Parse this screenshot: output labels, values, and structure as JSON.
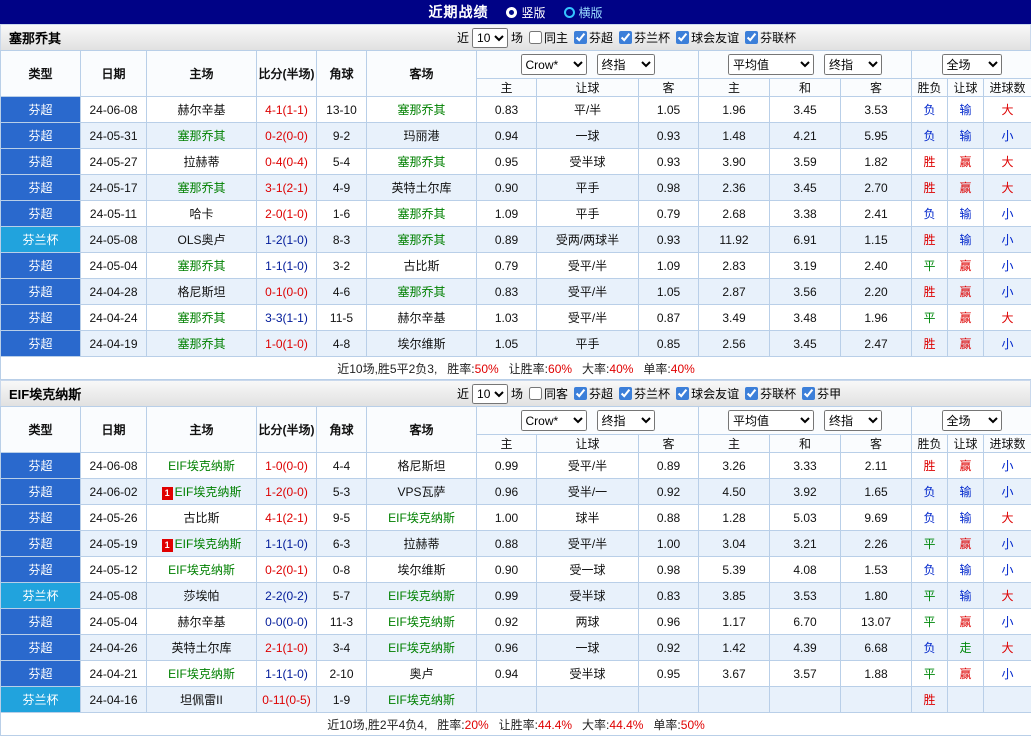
{
  "topbar": {
    "title": "近期战绩",
    "vertical": "竖版",
    "horizontal": "横版"
  },
  "controls": {
    "near": "近",
    "count": "10",
    "games": "场",
    "crow": "Crow*",
    "final1": "终指",
    "avg": "平均值",
    "final2": "终指",
    "full": "全场"
  },
  "columns": {
    "type": "类型",
    "date": "日期",
    "home": "主场",
    "score": "比分(半场)",
    "corner": "角球",
    "away": "客场",
    "sub": [
      "主",
      "让球",
      "客",
      "主",
      "和",
      "客",
      "胜负",
      "让球",
      "进球数"
    ]
  },
  "sections": [
    {
      "team": "塞那乔其",
      "filter": {
        "same": "同主",
        "same_checked": false,
        "leagues": [
          {
            "label": "芬超",
            "checked": true
          },
          {
            "label": "芬兰杯",
            "checked": true
          },
          {
            "label": "球会友谊",
            "checked": true
          },
          {
            "label": "芬联杯",
            "checked": true
          }
        ]
      },
      "rows": [
        {
          "comp": "芬超",
          "kindcls": "t-league",
          "date": "24-06-08",
          "badge": "",
          "home": "赫尔辛基",
          "homecls": "",
          "score": "4-1(1-1)",
          "scorecls": "c-red",
          "corners": "13-10",
          "away": "塞那乔其",
          "awaycls": "focus",
          "o1": "0.83",
          "hc": "平/半",
          "o2": "1.05",
          "e1": "1.96",
          "e2": "3.45",
          "e3": "3.53",
          "r1": "负",
          "r1cls": "c-blue",
          "r2": "输",
          "r2cls": "c-blue",
          "r3": "大",
          "r3cls": "c-red"
        },
        {
          "comp": "芬超",
          "kindcls": "t-league",
          "date": "24-05-31",
          "badge": "",
          "home": "塞那乔其",
          "homecls": "focus",
          "score": "0-2(0-0)",
          "scorecls": "c-red",
          "corners": "9-2",
          "away": "玛丽港",
          "awaycls": "",
          "o1": "0.94",
          "hc": "一球",
          "o2": "0.93",
          "e1": "1.48",
          "e2": "4.21",
          "e3": "5.95",
          "r1": "负",
          "r1cls": "c-blue",
          "r2": "输",
          "r2cls": "c-blue",
          "r3": "小",
          "r3cls": "c-blue"
        },
        {
          "comp": "芬超",
          "kindcls": "t-league",
          "date": "24-05-27",
          "badge": "",
          "home": "拉赫蒂",
          "homecls": "",
          "score": "0-4(0-4)",
          "scorecls": "c-red",
          "corners": "5-4",
          "away": "塞那乔其",
          "awaycls": "focus",
          "o1": "0.95",
          "hc": "受半球",
          "o2": "0.93",
          "e1": "3.90",
          "e2": "3.59",
          "e3": "1.82",
          "r1": "胜",
          "r1cls": "c-red",
          "r2": "赢",
          "r2cls": "c-red",
          "r3": "大",
          "r3cls": "c-red"
        },
        {
          "comp": "芬超",
          "kindcls": "t-league",
          "date": "24-05-17",
          "badge": "",
          "home": "塞那乔其",
          "homecls": "focus",
          "score": "3-1(2-1)",
          "scorecls": "c-red",
          "corners": "4-9",
          "away": "英特土尔库",
          "awaycls": "",
          "o1": "0.90",
          "hc": "平手",
          "o2": "0.98",
          "e1": "2.36",
          "e2": "3.45",
          "e3": "2.70",
          "r1": "胜",
          "r1cls": "c-red",
          "r2": "赢",
          "r2cls": "c-red",
          "r3": "大",
          "r3cls": "c-red"
        },
        {
          "comp": "芬超",
          "kindcls": "t-league",
          "date": "24-05-11",
          "badge": "",
          "home": "哈卡",
          "homecls": "",
          "score": "2-0(1-0)",
          "scorecls": "c-red",
          "corners": "1-6",
          "away": "塞那乔其",
          "awaycls": "focus",
          "o1": "1.09",
          "hc": "平手",
          "o2": "0.79",
          "e1": "2.68",
          "e2": "3.38",
          "e3": "2.41",
          "r1": "负",
          "r1cls": "c-blue",
          "r2": "输",
          "r2cls": "c-blue",
          "r3": "小",
          "r3cls": "c-blue"
        },
        {
          "comp": "芬兰杯",
          "kindcls": "t-cup",
          "date": "24-05-08",
          "badge": "",
          "home": "OLS奥卢",
          "homecls": "",
          "score": "1-2(1-0)",
          "scorecls": "c-navy",
          "corners": "8-3",
          "away": "塞那乔其",
          "awaycls": "focus",
          "o1": "0.89",
          "hc": "受两/两球半",
          "o2": "0.93",
          "e1": "11.92",
          "e2": "6.91",
          "e3": "1.15",
          "r1": "胜",
          "r1cls": "c-red",
          "r2": "输",
          "r2cls": "c-blue",
          "r3": "小",
          "r3cls": "c-blue"
        },
        {
          "comp": "芬超",
          "kindcls": "t-league",
          "date": "24-05-04",
          "badge": "",
          "home": "塞那乔其",
          "homecls": "focus",
          "score": "1-1(1-0)",
          "scorecls": "c-navy",
          "corners": "3-2",
          "away": "古比斯",
          "awaycls": "",
          "o1": "0.79",
          "hc": "受平/半",
          "o2": "1.09",
          "e1": "2.83",
          "e2": "3.19",
          "e3": "2.40",
          "r1": "平",
          "r1cls": "c-green",
          "r2": "赢",
          "r2cls": "c-red",
          "r3": "小",
          "r3cls": "c-blue"
        },
        {
          "comp": "芬超",
          "kindcls": "t-league",
          "date": "24-04-28",
          "badge": "",
          "home": "格尼斯坦",
          "homecls": "",
          "score": "0-1(0-0)",
          "scorecls": "c-red",
          "corners": "4-6",
          "away": "塞那乔其",
          "awaycls": "focus",
          "o1": "0.83",
          "hc": "受平/半",
          "o2": "1.05",
          "e1": "2.87",
          "e2": "3.56",
          "e3": "2.20",
          "r1": "胜",
          "r1cls": "c-red",
          "r2": "赢",
          "r2cls": "c-red",
          "r3": "小",
          "r3cls": "c-blue"
        },
        {
          "comp": "芬超",
          "kindcls": "t-league",
          "date": "24-04-24",
          "badge": "",
          "home": "塞那乔其",
          "homecls": "focus",
          "score": "3-3(1-1)",
          "scorecls": "c-navy",
          "corners": "11-5",
          "away": "赫尔辛基",
          "awaycls": "",
          "o1": "1.03",
          "hc": "受平/半",
          "o2": "0.87",
          "e1": "3.49",
          "e2": "3.48",
          "e3": "1.96",
          "r1": "平",
          "r1cls": "c-green",
          "r2": "赢",
          "r2cls": "c-red",
          "r3": "大",
          "r3cls": "c-red"
        },
        {
          "comp": "芬超",
          "kindcls": "t-league",
          "date": "24-04-19",
          "badge": "",
          "home": "塞那乔其",
          "homecls": "focus",
          "score": "1-0(1-0)",
          "scorecls": "c-red",
          "corners": "4-8",
          "away": "埃尔维斯",
          "awaycls": "",
          "o1": "1.05",
          "hc": "平手",
          "o2": "0.85",
          "e1": "2.56",
          "e2": "3.45",
          "e3": "2.47",
          "r1": "胜",
          "r1cls": "c-red",
          "r2": "赢",
          "r2cls": "c-red",
          "r3": "小",
          "r3cls": "c-blue"
        }
      ],
      "summary": {
        "prefix": "近10场,胜5平2负3,",
        "stats": [
          {
            "label": "胜率:",
            "value": "50%"
          },
          {
            "label": "让胜率:",
            "value": "60%"
          },
          {
            "label": "大率:",
            "value": "40%"
          },
          {
            "label": "单率:",
            "value": "40%"
          }
        ]
      }
    },
    {
      "team": "EIF埃克纳斯",
      "filter": {
        "same": "同客",
        "same_checked": false,
        "leagues": [
          {
            "label": "芬超",
            "checked": true
          },
          {
            "label": "芬兰杯",
            "checked": true
          },
          {
            "label": "球会友谊",
            "checked": true
          },
          {
            "label": "芬联杯",
            "checked": true
          },
          {
            "label": "芬甲",
            "checked": true
          }
        ]
      },
      "rows": [
        {
          "comp": "芬超",
          "kindcls": "t-league",
          "date": "24-06-08",
          "badge": "",
          "home": "EIF埃克纳斯",
          "homecls": "focus",
          "score": "1-0(0-0)",
          "scorecls": "c-red",
          "corners": "4-4",
          "away": "格尼斯坦",
          "awaycls": "",
          "o1": "0.99",
          "hc": "受平/半",
          "o2": "0.89",
          "e1": "3.26",
          "e2": "3.33",
          "e3": "2.11",
          "r1": "胜",
          "r1cls": "c-red",
          "r2": "赢",
          "r2cls": "c-red",
          "r3": "小",
          "r3cls": "c-blue"
        },
        {
          "comp": "芬超",
          "kindcls": "t-league",
          "date": "24-06-02",
          "badge": "1",
          "home": "EIF埃克纳斯",
          "homecls": "focus",
          "score": "1-2(0-0)",
          "scorecls": "c-red",
          "corners": "5-3",
          "away": "VPS瓦萨",
          "awaycls": "",
          "o1": "0.96",
          "hc": "受半/一",
          "o2": "0.92",
          "e1": "4.50",
          "e2": "3.92",
          "e3": "1.65",
          "r1": "负",
          "r1cls": "c-blue",
          "r2": "输",
          "r2cls": "c-blue",
          "r3": "小",
          "r3cls": "c-blue"
        },
        {
          "comp": "芬超",
          "kindcls": "t-league",
          "date": "24-05-26",
          "badge": "",
          "home": "古比斯",
          "homecls": "",
          "score": "4-1(2-1)",
          "scorecls": "c-red",
          "corners": "9-5",
          "away": "EIF埃克纳斯",
          "awaycls": "focus",
          "o1": "1.00",
          "hc": "球半",
          "o2": "0.88",
          "e1": "1.28",
          "e2": "5.03",
          "e3": "9.69",
          "r1": "负",
          "r1cls": "c-blue",
          "r2": "输",
          "r2cls": "c-blue",
          "r3": "大",
          "r3cls": "c-red"
        },
        {
          "comp": "芬超",
          "kindcls": "t-league",
          "date": "24-05-19",
          "badge": "1",
          "home": "EIF埃克纳斯",
          "homecls": "focus",
          "score": "1-1(1-0)",
          "scorecls": "c-navy",
          "corners": "6-3",
          "away": "拉赫蒂",
          "awaycls": "",
          "o1": "0.88",
          "hc": "受平/半",
          "o2": "1.00",
          "e1": "3.04",
          "e2": "3.21",
          "e3": "2.26",
          "r1": "平",
          "r1cls": "c-green",
          "r2": "赢",
          "r2cls": "c-red",
          "r3": "小",
          "r3cls": "c-blue"
        },
        {
          "comp": "芬超",
          "kindcls": "t-league",
          "date": "24-05-12",
          "badge": "",
          "home": "EIF埃克纳斯",
          "homecls": "focus",
          "score": "0-2(0-1)",
          "scorecls": "c-red",
          "corners": "0-8",
          "away": "埃尔维斯",
          "awaycls": "",
          "o1": "0.90",
          "hc": "受一球",
          "o2": "0.98",
          "e1": "5.39",
          "e2": "4.08",
          "e3": "1.53",
          "r1": "负",
          "r1cls": "c-blue",
          "r2": "输",
          "r2cls": "c-blue",
          "r3": "小",
          "r3cls": "c-blue"
        },
        {
          "comp": "芬兰杯",
          "kindcls": "t-cup",
          "date": "24-05-08",
          "badge": "",
          "home": "莎埃帕",
          "homecls": "",
          "score": "2-2(0-2)",
          "scorecls": "c-navy",
          "corners": "5-7",
          "away": "EIF埃克纳斯",
          "awaycls": "focus",
          "o1": "0.99",
          "hc": "受半球",
          "o2": "0.83",
          "e1": "3.85",
          "e2": "3.53",
          "e3": "1.80",
          "r1": "平",
          "r1cls": "c-green",
          "r2": "输",
          "r2cls": "c-blue",
          "r3": "大",
          "r3cls": "c-red"
        },
        {
          "comp": "芬超",
          "kindcls": "t-league",
          "date": "24-05-04",
          "badge": "",
          "home": "赫尔辛基",
          "homecls": "",
          "score": "0-0(0-0)",
          "scorecls": "c-navy",
          "corners": "11-3",
          "away": "EIF埃克纳斯",
          "awaycls": "focus",
          "o1": "0.92",
          "hc": "两球",
          "o2": "0.96",
          "e1": "1.17",
          "e2": "6.70",
          "e3": "13.07",
          "r1": "平",
          "r1cls": "c-green",
          "r2": "赢",
          "r2cls": "c-red",
          "r3": "小",
          "r3cls": "c-blue"
        },
        {
          "comp": "芬超",
          "kindcls": "t-league",
          "date": "24-04-26",
          "badge": "",
          "home": "英特土尔库",
          "homecls": "",
          "score": "2-1(1-0)",
          "scorecls": "c-red",
          "corners": "3-4",
          "away": "EIF埃克纳斯",
          "awaycls": "focus",
          "o1": "0.96",
          "hc": "一球",
          "o2": "0.92",
          "e1": "1.42",
          "e2": "4.39",
          "e3": "6.68",
          "r1": "负",
          "r1cls": "c-blue",
          "r2": "走",
          "r2cls": "c-green",
          "r3": "大",
          "r3cls": "c-red"
        },
        {
          "comp": "芬超",
          "kindcls": "t-league",
          "date": "24-04-21",
          "badge": "",
          "home": "EIF埃克纳斯",
          "homecls": "focus",
          "score": "1-1(1-0)",
          "scorecls": "c-navy",
          "corners": "2-10",
          "away": "奥卢",
          "awaycls": "",
          "o1": "0.94",
          "hc": "受半球",
          "o2": "0.95",
          "e1": "3.67",
          "e2": "3.57",
          "e3": "1.88",
          "r1": "平",
          "r1cls": "c-green",
          "r2": "赢",
          "r2cls": "c-red",
          "r3": "小",
          "r3cls": "c-blue"
        },
        {
          "comp": "芬兰杯",
          "kindcls": "t-cup",
          "date": "24-04-16",
          "badge": "",
          "home": "坦佩雷II",
          "homecls": "",
          "score": "0-11(0-5)",
          "scorecls": "c-red",
          "corners": "1-9",
          "away": "EIF埃克纳斯",
          "awaycls": "focus",
          "o1": "",
          "hc": "",
          "o2": "",
          "e1": "",
          "e2": "",
          "e3": "",
          "r1": "胜",
          "r1cls": "c-red",
          "r2": "",
          "r2cls": "",
          "r3": "",
          "r3cls": ""
        }
      ],
      "summary": {
        "prefix": "近10场,胜2平4负4,",
        "stats": [
          {
            "label": "胜率:",
            "value": "20%"
          },
          {
            "label": "让胜率:",
            "value": "44.4%"
          },
          {
            "label": "大率:",
            "value": "44.4%"
          },
          {
            "label": "单率:",
            "value": "50%"
          }
        ]
      }
    }
  ]
}
